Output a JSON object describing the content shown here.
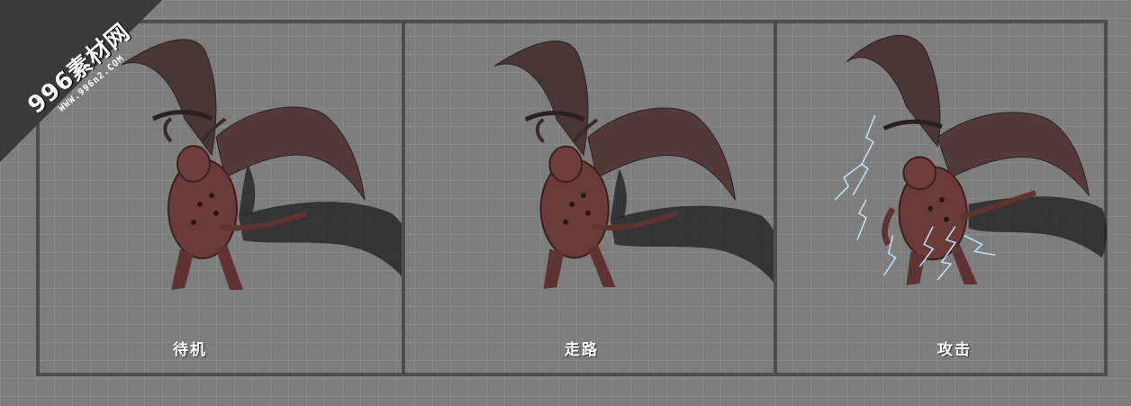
{
  "watermark": {
    "brand": "996素材网",
    "url": "WWW.996n2.COM"
  },
  "panels": [
    {
      "label": "待机",
      "state": "idle"
    },
    {
      "label": "走路",
      "state": "walk"
    },
    {
      "label": "攻击",
      "state": "attack"
    }
  ],
  "colors": {
    "background": "#7d7d7d",
    "grid": "#8a8a8a",
    "frame": "#4d4d4d",
    "creature": "#6b3b3a",
    "shadow": "#222222",
    "lightning": "#bfe6ff"
  }
}
